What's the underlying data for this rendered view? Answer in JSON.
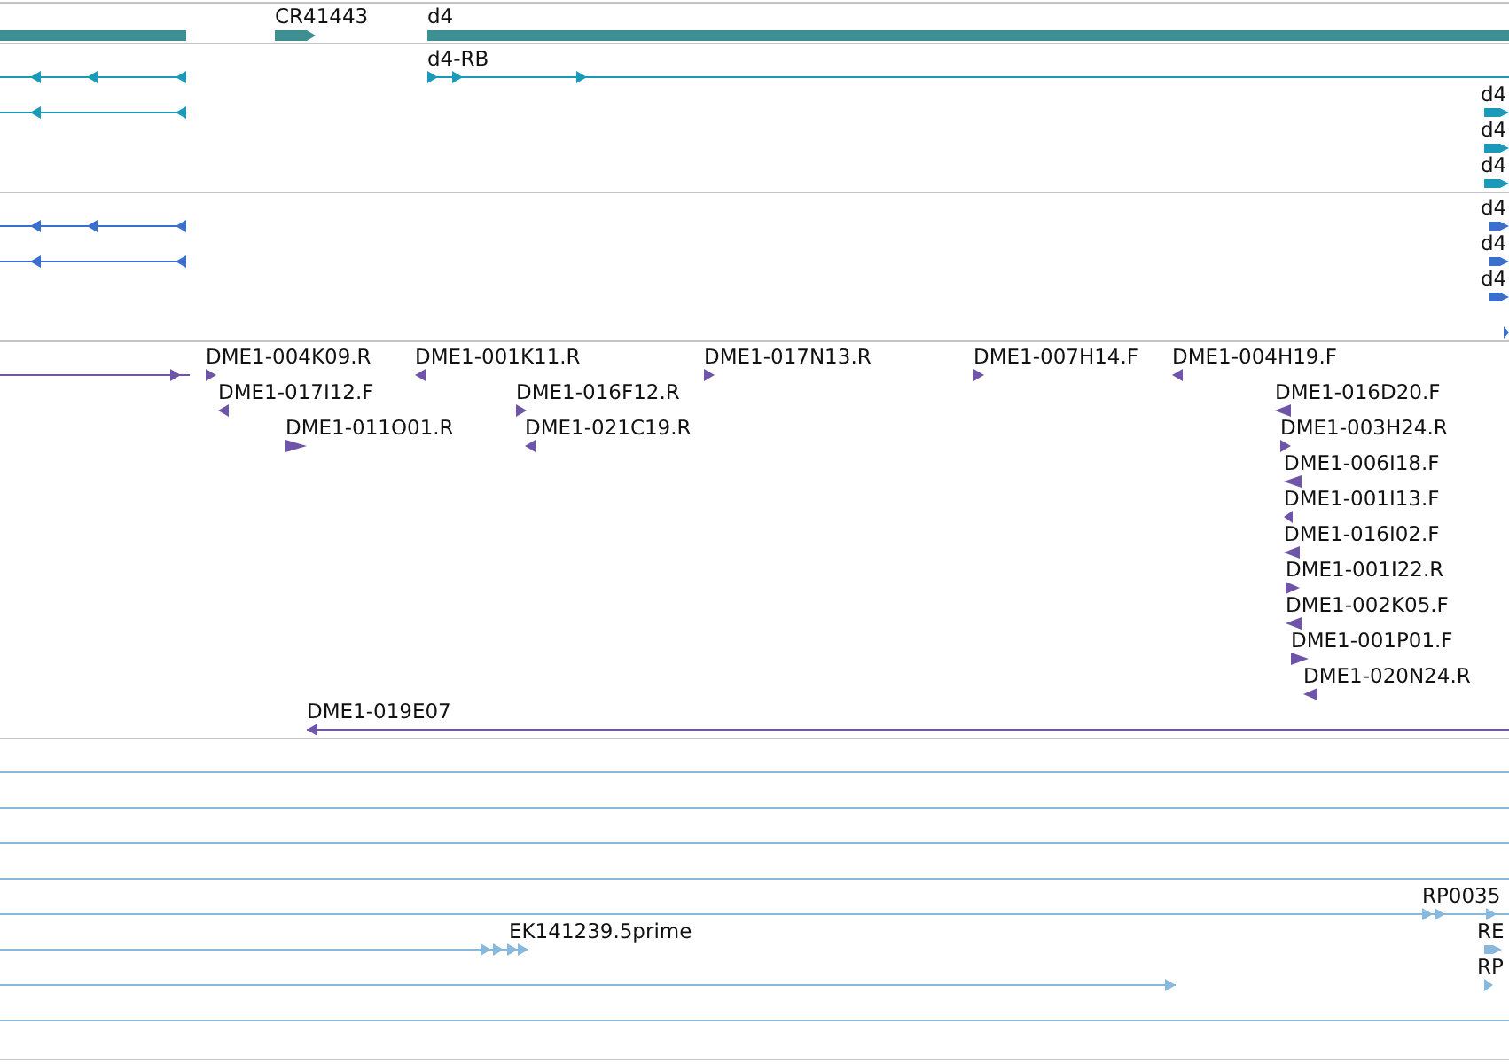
{
  "tracks": [
    {
      "color": "#3d8f91",
      "features": [
        {
          "kind": "bar"
        },
        {
          "kind": "bar",
          "reverse": false,
          "label": "CR41443"
        },
        {
          "kind": "bar",
          "label": "d4"
        }
      ]
    },
    {
      "color": "#1a9ab8",
      "features": [
        {
          "kind": "line",
          "reverse": true
        },
        {
          "kind": "line",
          "reverse": true
        },
        {
          "kind": "line",
          "reverse": false,
          "label": "d4-RB"
        },
        {
          "kind": "bar",
          "reverse": false,
          "label": "d4"
        },
        {
          "kind": "bar",
          "reverse": false,
          "label": "d4"
        },
        {
          "kind": "bar",
          "reverse": false,
          "label": "d4"
        }
      ]
    },
    {
      "color": "#3a6fd0",
      "features": [
        {
          "kind": "line",
          "reverse": true
        },
        {
          "kind": "line",
          "reverse": true
        },
        {
          "kind": "bar",
          "reverse": false,
          "label": "d4"
        },
        {
          "kind": "bar",
          "reverse": false,
          "label": "d4"
        },
        {
          "kind": "bar",
          "reverse": false,
          "label": "d4"
        },
        {
          "kind": "tick",
          "reverse": false
        }
      ]
    },
    {
      "color": "#6e55a8",
      "features": [
        {
          "kind": "line",
          "reverse": false
        },
        {
          "kind": "tick",
          "reverse": false,
          "label": "DME1-004K09.R"
        },
        {
          "kind": "tick",
          "reverse": true,
          "label": "DME1-017I12.F"
        },
        {
          "kind": "tick",
          "reverse": false,
          "label": "DME1-011O01.R"
        },
        {
          "kind": "tick",
          "reverse": true,
          "label": "DME1-001K11.R"
        },
        {
          "kind": "tick",
          "reverse": false,
          "label": "DME1-016F12.R"
        },
        {
          "kind": "tick",
          "reverse": true,
          "label": "DME1-021C19.R"
        },
        {
          "kind": "tick",
          "reverse": false,
          "label": "DME1-017N13.R"
        },
        {
          "kind": "tick",
          "reverse": false,
          "label": "DME1-007H14.F"
        },
        {
          "kind": "tick",
          "reverse": true,
          "label": "DME1-004H19.F"
        },
        {
          "kind": "tick",
          "reverse": true,
          "label": "DME1-016D20.F"
        },
        {
          "kind": "tick",
          "reverse": false,
          "label": "DME1-003H24.R"
        },
        {
          "kind": "tick",
          "reverse": true,
          "label": "DME1-006I18.F"
        },
        {
          "kind": "tick",
          "reverse": true,
          "label": "DME1-001I13.F"
        },
        {
          "kind": "tick",
          "reverse": true,
          "label": "DME1-016I02.F"
        },
        {
          "kind": "tick",
          "reverse": false,
          "label": "DME1-001I22.R"
        },
        {
          "kind": "tick",
          "reverse": true,
          "label": "DME1-002K05.F"
        },
        {
          "kind": "tick",
          "reverse": false,
          "label": "DME1-001P01.F"
        },
        {
          "kind": "tick",
          "reverse": true,
          "label": "DME1-020N24.R"
        },
        {
          "kind": "line",
          "reverse": true,
          "label": "DME1-019E07"
        }
      ]
    },
    {
      "color": "#88b8dc",
      "features": [
        {
          "kind": "line"
        },
        {
          "kind": "line"
        },
        {
          "kind": "line"
        },
        {
          "kind": "line"
        },
        {
          "kind": "line",
          "reverse": false,
          "label": "RP0035"
        },
        {
          "kind": "line",
          "reverse": false,
          "label": "EK141239.5prime"
        },
        {
          "kind": "bar",
          "reverse": false,
          "label": "RE"
        },
        {
          "kind": "line",
          "reverse": false
        },
        {
          "kind": "tick",
          "reverse": false,
          "label": "RP"
        },
        {
          "kind": "line"
        }
      ]
    }
  ]
}
